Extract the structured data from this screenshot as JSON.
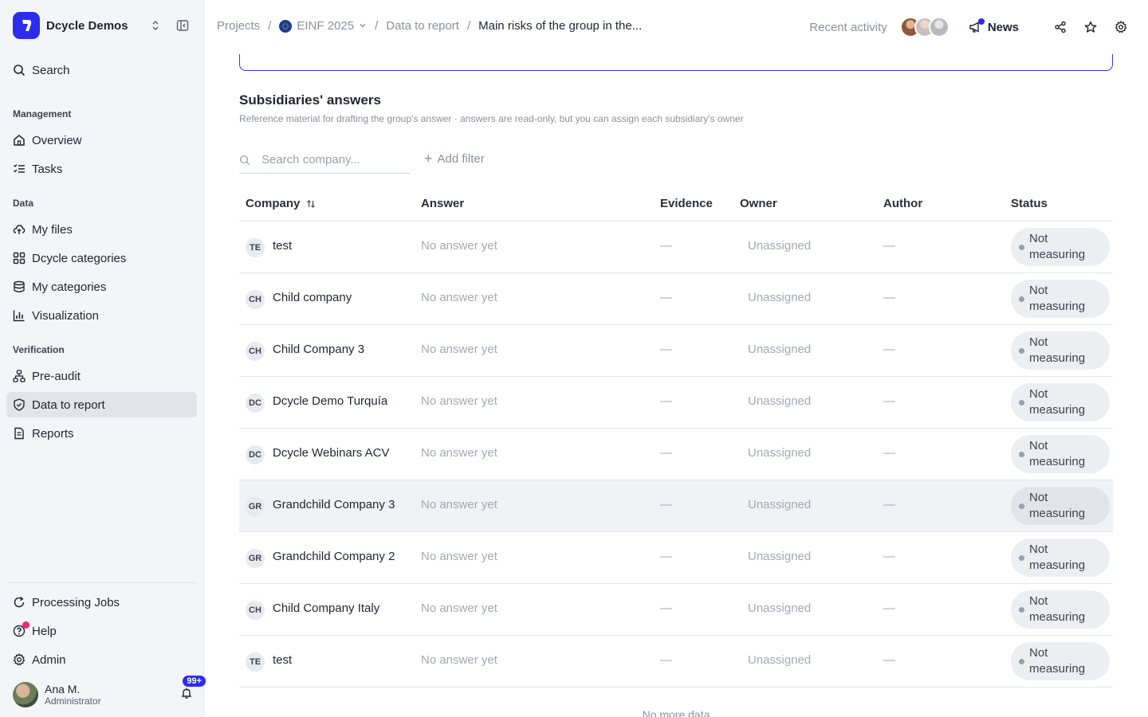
{
  "brand": {
    "name": "Dcycle Demos"
  },
  "sidebar": {
    "search_label": "Search",
    "sections": {
      "management": "Management",
      "data": "Data",
      "verification": "Verification"
    },
    "items": {
      "overview": "Overview",
      "tasks": "Tasks",
      "my_files": "My files",
      "dcycle_categories": "Dcycle categories",
      "my_categories": "My categories",
      "visualization": "Visualization",
      "pre_audit": "Pre-audit",
      "data_to_report": "Data to report",
      "reports": "Reports",
      "processing_jobs": "Processing Jobs",
      "help": "Help",
      "admin": "Admin"
    },
    "active_item": "data_to_report",
    "user": {
      "name": "Ana M.",
      "role": "Administrator",
      "notifications": "99+"
    }
  },
  "breadcrumb": {
    "projects": "Projects",
    "project": "EINF 2025",
    "section": "Data to report",
    "current": "Main risks of the group in the..."
  },
  "topbar": {
    "recent_activity": "Recent activity",
    "news": "News"
  },
  "subsidiaries": {
    "title": "Subsidiaries' answers",
    "description": "Reference material for drafting the group's answer · answers are read-only, but you can assign each subsidiary's owner",
    "search_placeholder": "Search company...",
    "add_filter": "Add filter",
    "columns": {
      "company": "Company",
      "answer": "Answer",
      "evidence": "Evidence",
      "owner": "Owner",
      "author": "Author",
      "status": "Status"
    },
    "rows": [
      {
        "initials": "TE",
        "company": "test",
        "answer": "No answer yet",
        "evidence": "—",
        "owner": "Unassigned",
        "author": "—",
        "status": "Not measuring"
      },
      {
        "initials": "CH",
        "company": "Child company",
        "answer": "No answer yet",
        "evidence": "—",
        "owner": "Unassigned",
        "author": "—",
        "status": "Not measuring"
      },
      {
        "initials": "CH",
        "company": "Child Company 3",
        "answer": "No answer yet",
        "evidence": "—",
        "owner": "Unassigned",
        "author": "—",
        "status": "Not measuring"
      },
      {
        "initials": "DC",
        "company": "Dcycle Demo Turquía",
        "answer": "No answer yet",
        "evidence": "—",
        "owner": "Unassigned",
        "author": "—",
        "status": "Not measuring"
      },
      {
        "initials": "DC",
        "company": "Dcycle Webinars ACV",
        "answer": "No answer yet",
        "evidence": "—",
        "owner": "Unassigned",
        "author": "—",
        "status": "Not measuring"
      },
      {
        "initials": "GR",
        "company": "Grandchild Company 3",
        "answer": "No answer yet",
        "evidence": "—",
        "owner": "Unassigned",
        "author": "—",
        "status": "Not measuring"
      },
      {
        "initials": "GR",
        "company": "Grandchild Company 2",
        "answer": "No answer yet",
        "evidence": "—",
        "owner": "Unassigned",
        "author": "—",
        "status": "Not measuring"
      },
      {
        "initials": "CH",
        "company": "Child Company Italy",
        "answer": "No answer yet",
        "evidence": "—",
        "owner": "Unassigned",
        "author": "—",
        "status": "Not measuring"
      },
      {
        "initials": "TE",
        "company": "test",
        "answer": "No answer yet",
        "evidence": "—",
        "owner": "Unassigned",
        "author": "—",
        "status": "Not measuring"
      }
    ],
    "hovered_row": 5,
    "footer": "No more data"
  },
  "colors": {
    "accent": "#2c2cf0",
    "help_dot": "#f0247a"
  }
}
